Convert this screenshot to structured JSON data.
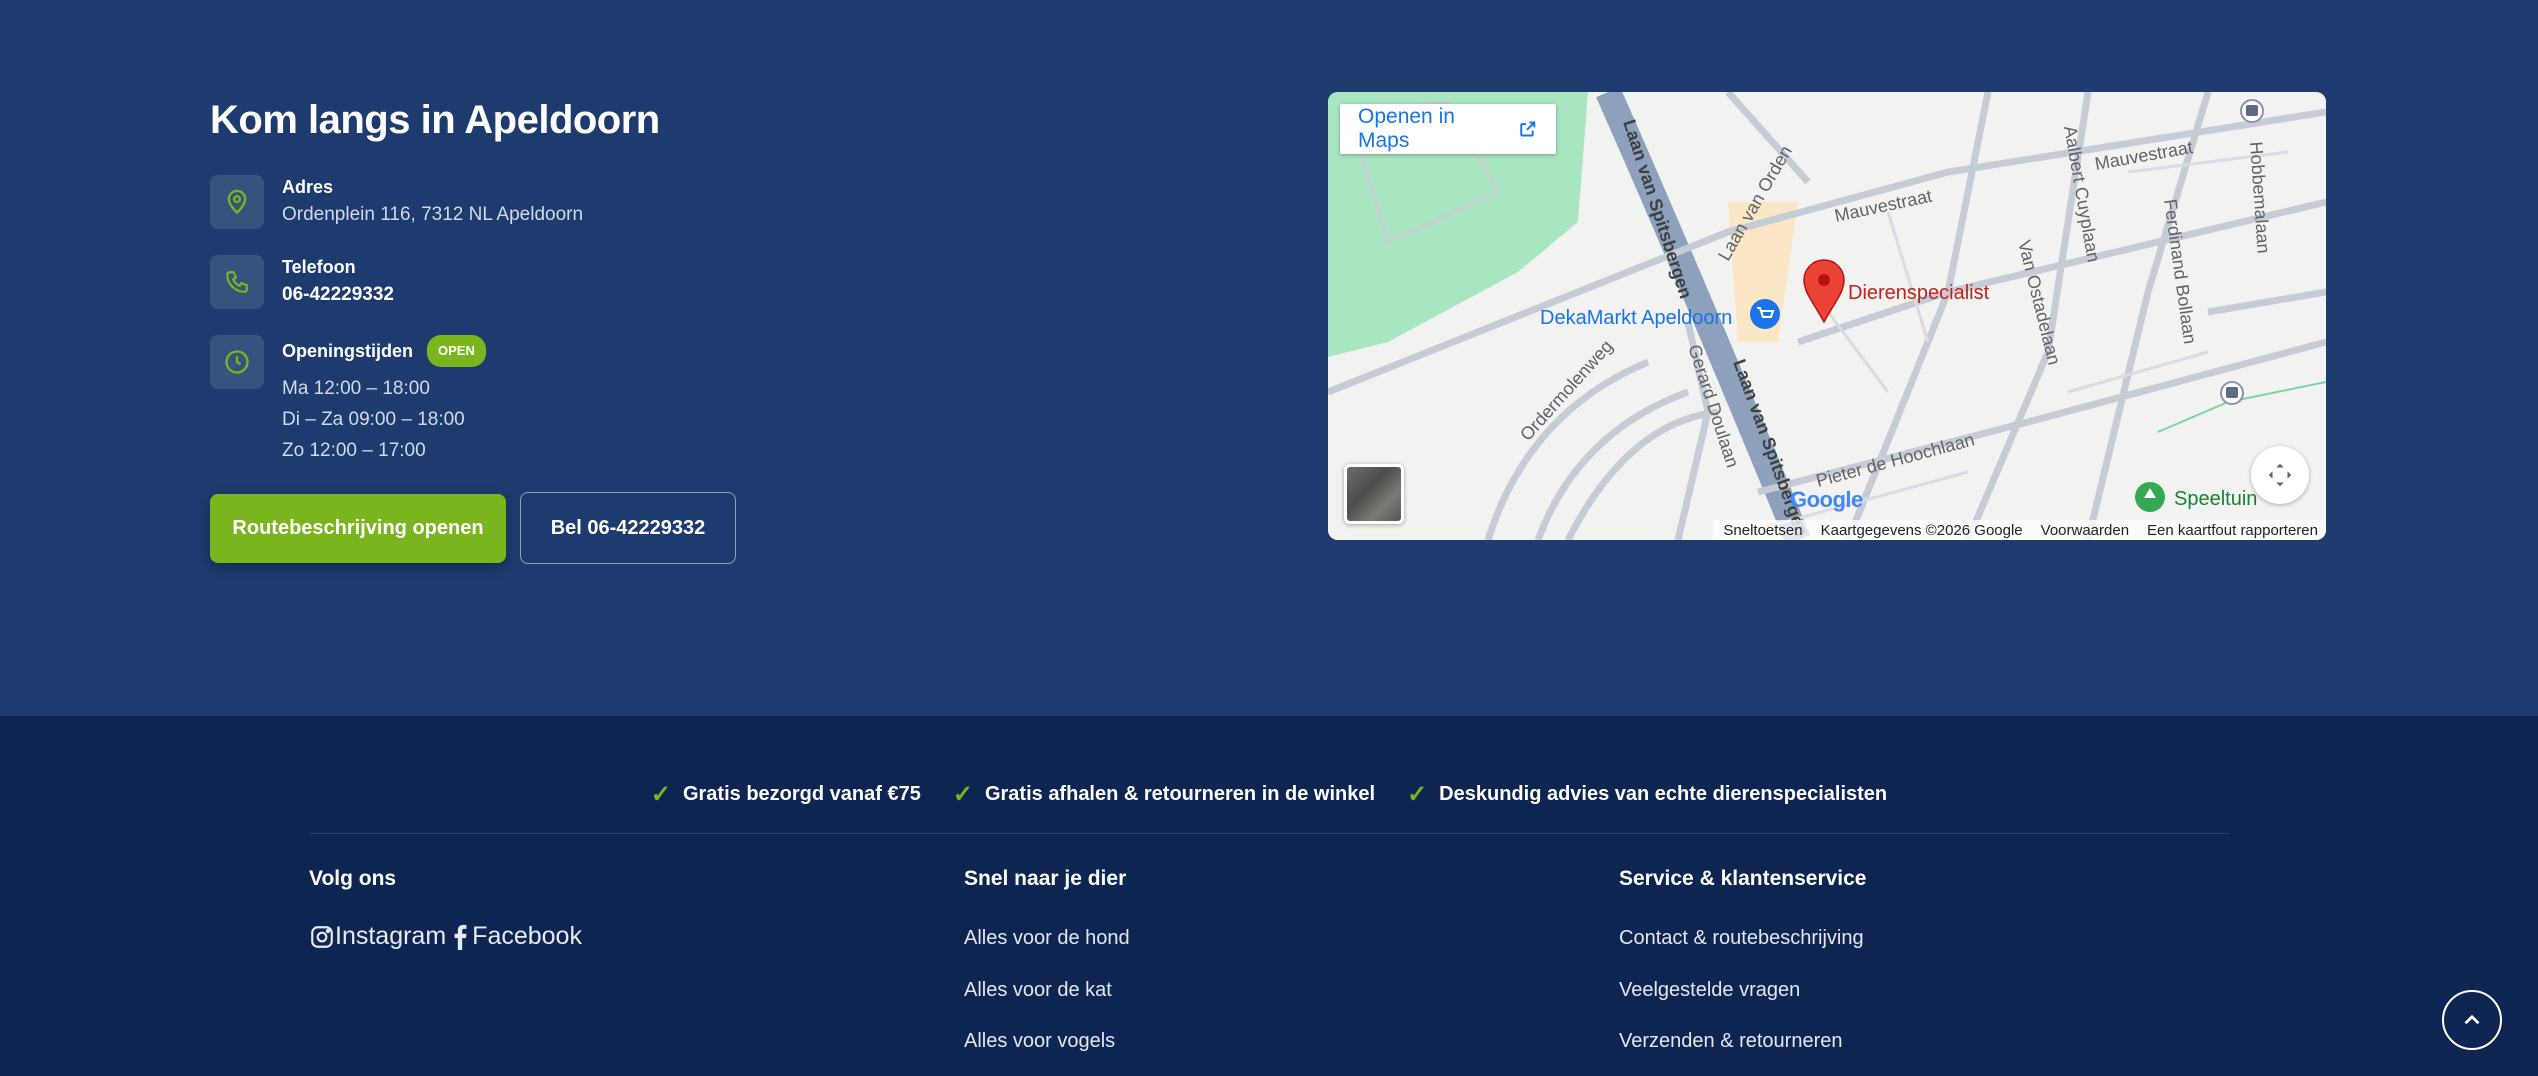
{
  "contact": {
    "title": "Kom langs in Apeldoorn",
    "address_label": "Adres",
    "address_value": "Ordenplein 116, 7312 NL Apeldoorn",
    "phone_label": "Telefoon",
    "phone_value": "06-42229332",
    "hours_label": "Openingstijden",
    "hours_badge": "OPEN",
    "hours": [
      "Ma 12:00 – 18:00",
      "Di – Za 09:00 – 18:00",
      "Zo 12:00 – 17:00"
    ],
    "route_button": "Routebeschrijving openen",
    "call_button": "Bel 06-42229332"
  },
  "map": {
    "open_in_maps": "Openen in Maps",
    "marker_label": "Dierenspecialist",
    "poi_label": "DekaMarkt Apeldoorn",
    "park_label": "Speeltuin",
    "streets": [
      "Laan van Spitsbergen",
      "Laan van Orden",
      "Mauvestraat",
      "Aalbert Cuyplaan",
      "Hobbemalaan",
      "Ferdinand Bollaan",
      "Van Ostadelaan",
      "Ordermolenweg",
      "Gerard Doulaan",
      "Pieter de Hoochlaan"
    ],
    "attribution": [
      "Sneltoetsen",
      "Kaartgegevens ©2026 Google",
      "Voorwaarden",
      "Een kaartfout rapporteren"
    ],
    "google_logo": "Google",
    "colors": {
      "marker": "#ea4335",
      "poi": "#1a73e8",
      "park": "#a8e6c1"
    }
  },
  "footer": {
    "usps": [
      "Gratis bezorgd vanaf €75",
      "Gratis afhalen & retourneren in de winkel",
      "Deskundig advies van echte dierenspecialisten"
    ],
    "follow_title": "Volg ons",
    "social": [
      {
        "label": "Instagram",
        "icon": "instagram-icon"
      },
      {
        "label": "Facebook",
        "icon": "facebook-icon"
      }
    ],
    "animals_title": "Snel naar je dier",
    "animals": [
      "Alles voor de hond",
      "Alles voor de kat",
      "Alles voor vogels"
    ],
    "service_title": "Service & klantenservice",
    "service": [
      "Contact & routebeschrijving",
      "Veelgestelde vragen",
      "Verzenden & retourneren"
    ]
  },
  "colors": {
    "navy": "#1d3b6e",
    "footer_navy": "#0f2551",
    "accent": "#7ab51d"
  }
}
